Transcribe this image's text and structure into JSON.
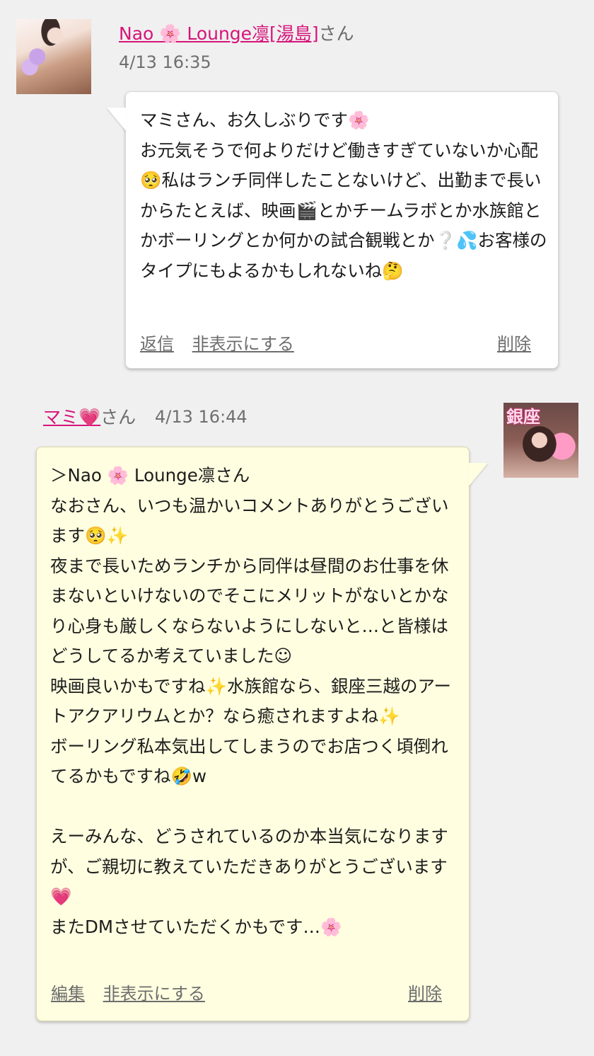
{
  "comments": [
    {
      "author_name": "Nao 🌸 Lounge凛[湯島]",
      "honorific": "さん",
      "timestamp": "4/13 16:35",
      "body": "マミさん、お久しぶりです🌸\nお元気そうで何よりだけど働きすぎていないか心配🥺私はランチ同伴したことないけど、出勤まで長いからたとえば、映画🎬とかチームラボとか水族館とかボーリングとか何かの試合観戦とか❔💦お客様のタイプにもよるかもしれないね🤔",
      "actions": {
        "reply": "返信",
        "hide": "非表示にする",
        "delete": "削除"
      }
    },
    {
      "author_name": "マミ💗",
      "honorific": "さん",
      "timestamp": "4/13 16:44",
      "avatar_badge": "銀座",
      "body": "＞Nao 🌸 Lounge凛さん\nなおさん、いつも温かいコメントありがとうございます🥺✨\n夜まで長いためランチから同伴は昼間のお仕事を休まないといけないのでそこにメリットがないとかなり心身も厳しくならないようにしないと…と皆様はどうしてるか考えていました☺\n映画良いかもですね✨水族館なら、銀座三越のアートアクアリウムとか？なら癒されますよね✨\nボーリング私本気出してしまうのでお店つく頃倒れてるかもですね🤣w\n\nえーみんな、どうされているのか本当気になりますが、ご親切に教えていただきありがとうございます💗\nまたDMさせていただくかもです…🌸",
      "actions": {
        "edit": "編集",
        "hide": "非表示にする",
        "delete": "削除"
      }
    }
  ],
  "colors": {
    "background": "#f0f0f0",
    "name_link": "#d6147a",
    "bubble_white": "#ffffff",
    "bubble_yellow": "#fffee0",
    "meta_text": "#6f6f6f"
  },
  "icons": {
    "avatar_1": "kimono-portrait-avatar",
    "avatar_2": "ginza-portrait-avatar"
  }
}
